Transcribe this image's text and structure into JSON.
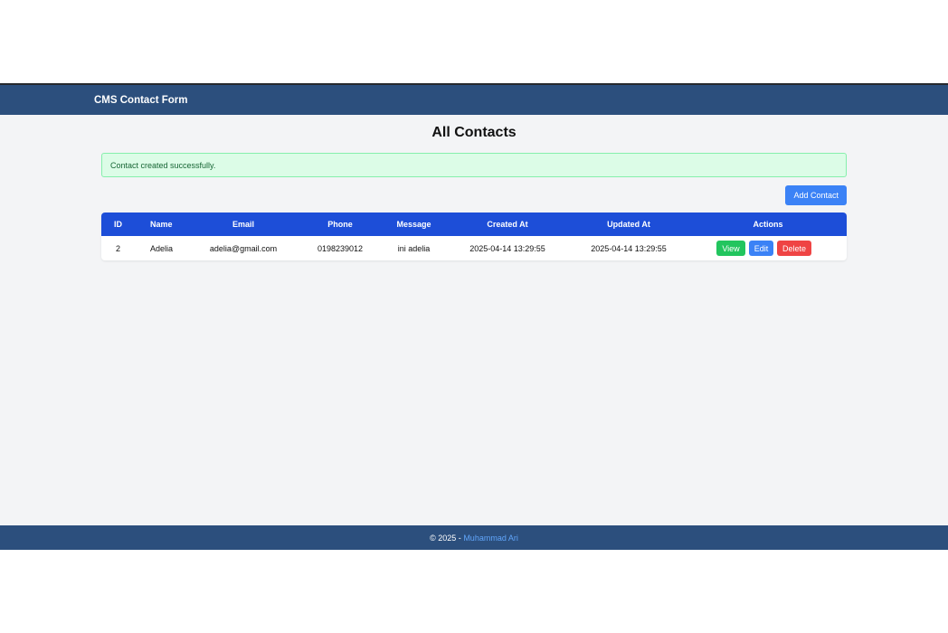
{
  "header": {
    "brand": "CMS Contact Form"
  },
  "page": {
    "title": "All Contacts"
  },
  "alert": {
    "message": "Contact created successfully."
  },
  "toolbar": {
    "add_label": "Add Contact"
  },
  "table": {
    "columns": [
      "ID",
      "Name",
      "Email",
      "Phone",
      "Message",
      "Created At",
      "Updated At",
      "Actions"
    ],
    "rows": [
      {
        "id": "2",
        "name": "Adelia",
        "email": "adelia@gmail.com",
        "phone": "0198239012",
        "message": "ini adelia",
        "created_at": "2025-04-14 13:29:55",
        "updated_at": "2025-04-14 13:29:55"
      }
    ],
    "actions": {
      "view": "View",
      "edit": "Edit",
      "delete": "Delete"
    }
  },
  "footer": {
    "copyright": "© 2025 - ",
    "author": "Muhammad Ari"
  },
  "colors": {
    "navbar": "#2c4f7d",
    "table_header": "#1d4ed8",
    "view": "#22c55e",
    "edit": "#3b82f6",
    "delete": "#ef4444",
    "alert_bg": "#dcfce7"
  }
}
